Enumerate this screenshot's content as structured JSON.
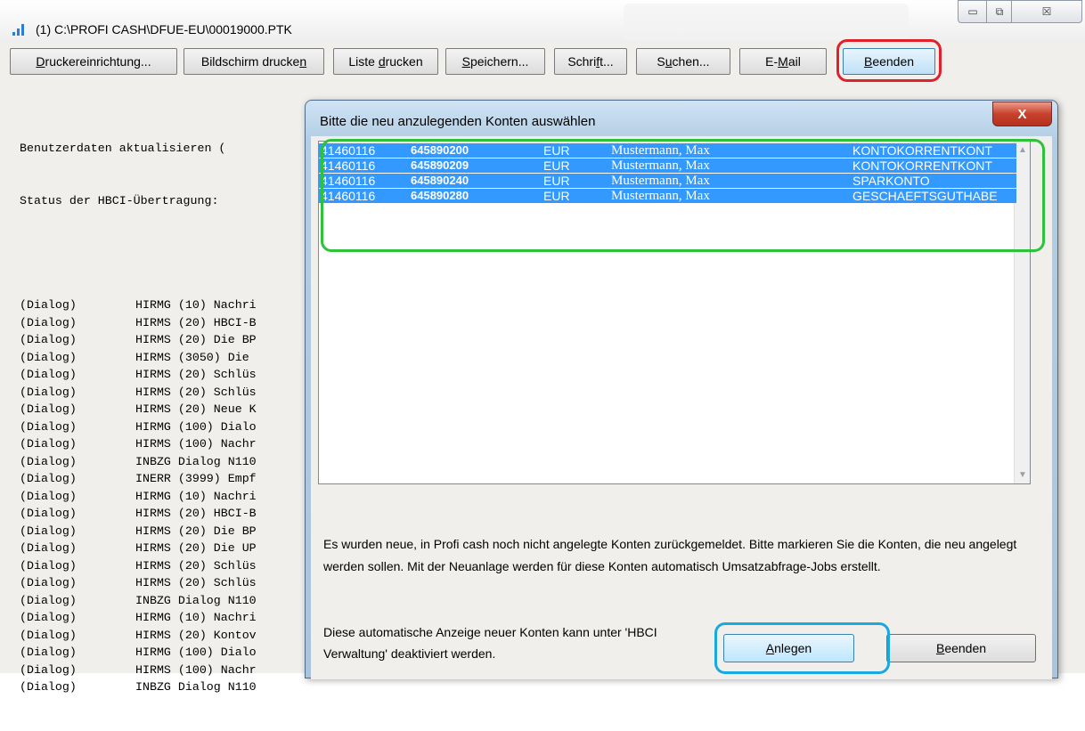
{
  "window": {
    "title": "(1) C:\\PROFI CASH\\DFUE-EU\\00019000.PTK",
    "minimize_glyph": "▭",
    "maximize_glyph": "⧉",
    "close_glyph": "☒"
  },
  "toolbar": {
    "buttons": [
      {
        "id": "druckereinrichtung",
        "label": "Druckereinrichtung...",
        "mnemonic": "D"
      },
      {
        "id": "bildschirm-drucken",
        "label": "Bildschirm drucken",
        "mnemonic": "n"
      },
      {
        "id": "liste-drucken",
        "label": "Liste drucken",
        "mnemonic": "d"
      },
      {
        "id": "speichern",
        "label": "Speichern...",
        "mnemonic": "S"
      },
      {
        "id": "schrift",
        "label": "Schrift...",
        "mnemonic": "f"
      },
      {
        "id": "suchen",
        "label": "Suchen...",
        "mnemonic": "u"
      },
      {
        "id": "e-mail",
        "label": "E-Mail",
        "mnemonic": "M"
      },
      {
        "id": "beenden",
        "label": "Beenden",
        "mnemonic": "B"
      }
    ]
  },
  "log": {
    "header_lines": [
      "Benutzerdaten aktualisieren (",
      "Status der HBCI-Übertragung:"
    ],
    "entries": [
      {
        "tag": "(Dialog)",
        "text": "HIRMG (10) Nachri"
      },
      {
        "tag": "(Dialog)",
        "text": "HIRMS (20) HBCI-B"
      },
      {
        "tag": "(Dialog)",
        "text": "HIRMS (20) Die BP"
      },
      {
        "tag": "(Dialog)",
        "text": "HIRMS (3050) Die "
      },
      {
        "tag": "(Dialog)",
        "text": "HIRMS (20) Schlüs"
      },
      {
        "tag": "(Dialog)",
        "text": "HIRMS (20) Schlüs"
      },
      {
        "tag": "(Dialog)",
        "text": "HIRMS (20) Neue K"
      },
      {
        "tag": "(Dialog)",
        "text": "HIRMG (100) Dialo"
      },
      {
        "tag": "(Dialog)",
        "text": "HIRMS (100) Nachr"
      },
      {
        "tag": "(Dialog)",
        "text": "INBZG Dialog N110"
      },
      {
        "tag": "(Dialog)",
        "text": "INERR (3999) Empf"
      },
      {
        "tag": "(Dialog)",
        "text": "HIRMG (10) Nachri"
      },
      {
        "tag": "(Dialog)",
        "text": "HIRMS (20) HBCI-B"
      },
      {
        "tag": "(Dialog)",
        "text": "HIRMS (20) Die BP"
      },
      {
        "tag": "(Dialog)",
        "text": "HIRMS (20) Die UP"
      },
      {
        "tag": "(Dialog)",
        "text": "HIRMS (20) Schlüs"
      },
      {
        "tag": "(Dialog)",
        "text": "HIRMS (20) Schlüs"
      },
      {
        "tag": "(Dialog)",
        "text": "INBZG Dialog N110"
      },
      {
        "tag": "(Dialog)",
        "text": "HIRMG (10) Nachri"
      },
      {
        "tag": "(Dialog)",
        "text": "HIRMS (20) Kontov"
      },
      {
        "tag": "(Dialog)",
        "text": "HIRMG (100) Dialo"
      },
      {
        "tag": "(Dialog)",
        "text": "HIRMS (100) Nachr"
      },
      {
        "tag": "(Dialog)",
        "text": "INBZG Dialog N110"
      }
    ]
  },
  "dialog": {
    "title": "Bitte die neu anzulegenden Konten auswählen",
    "close_label": "X",
    "accounts": [
      {
        "blz": "41460116",
        "number": "645890200",
        "currency": "EUR",
        "name": "Mustermann, Max",
        "type": "KONTOKORRENTKONT"
      },
      {
        "blz": "41460116",
        "number": "645890209",
        "currency": "EUR",
        "name": "Mustermann, Max",
        "type": "KONTOKORRENTKONT"
      },
      {
        "blz": "41460116",
        "number": "645890240",
        "currency": "EUR",
        "name": "Mustermann, Max",
        "type": "SPARKONTO"
      },
      {
        "blz": "41460116",
        "number": "645890280",
        "currency": "EUR",
        "name": "Mustermann, Max",
        "type": "GESCHAEFTSGUTHABE"
      }
    ],
    "info_text": "Es wurden neue, in Profi cash noch nicht angelegte Konten zurückgemeldet. Bitte markieren Sie die Konten, die neu angelegt werden sollen. Mit der Neuanlage werden für diese Konten automatisch Umsatzabfrage-Jobs erstellt.",
    "hint_text": "Diese automatische Anzeige neuer Konten kann unter 'HBCI Verwaltung' deaktiviert werden.",
    "anlegen_label": "Anlegen",
    "beenden_label": "Beenden"
  }
}
